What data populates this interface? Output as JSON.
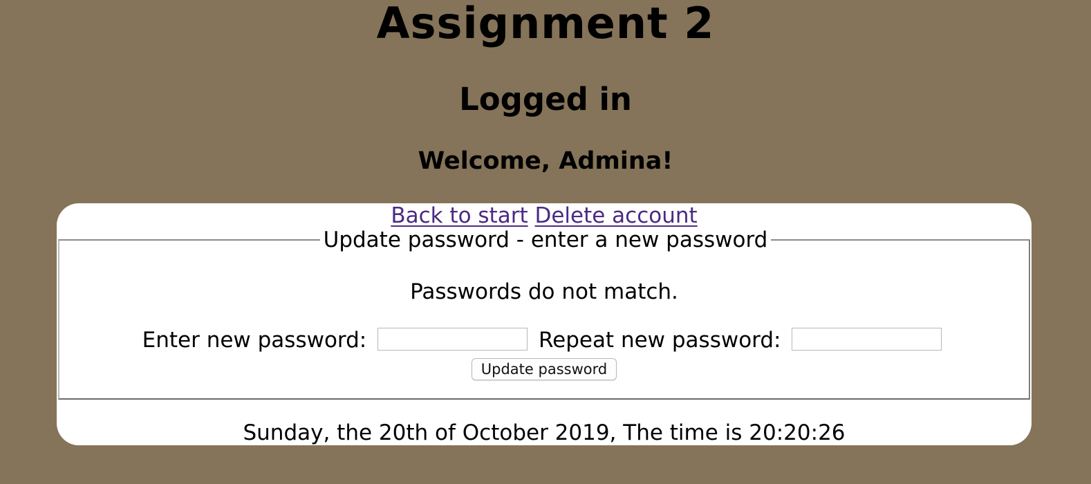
{
  "header": {
    "title": "Assignment 2",
    "subtitle": "Logged in",
    "welcome": "Welcome, Admina!"
  },
  "nav": {
    "back_label": "Back to start",
    "delete_label": "Delete account"
  },
  "form": {
    "legend": "Update password - enter a new password",
    "message": "Passwords do not match.",
    "new_password_label": "Enter new password:",
    "new_password_value": "",
    "repeat_password_label": "Repeat new password:",
    "repeat_password_value": "",
    "submit_label": "Update password"
  },
  "footer": {
    "datetime": "Sunday, the 20th of October 2019, The time is 20:20:26"
  },
  "colors": {
    "page_background": "#857459",
    "card_background": "#ffffff",
    "link": "#4b2a83"
  }
}
